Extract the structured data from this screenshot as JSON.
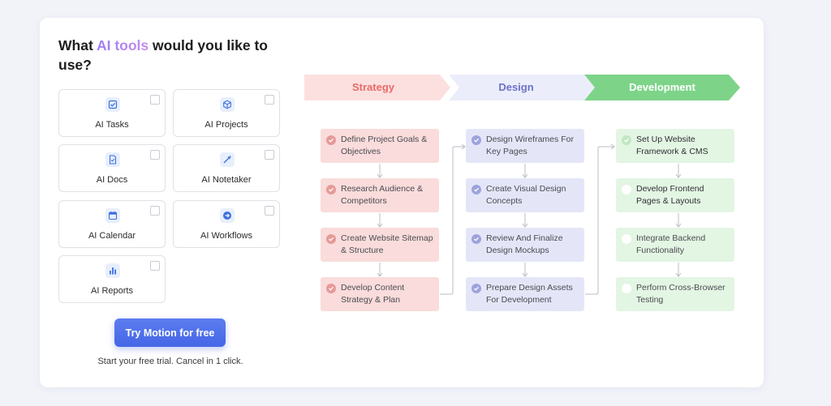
{
  "heading": {
    "before": "What ",
    "accent": "AI tools",
    "after": " would you like to use?"
  },
  "tools": [
    {
      "label": "AI Tasks",
      "icon": "task-check-icon"
    },
    {
      "label": "AI Projects",
      "icon": "cube-icon"
    },
    {
      "label": "AI Docs",
      "icon": "doc-icon"
    },
    {
      "label": "AI Notetaker",
      "icon": "pen-sparkle-icon"
    },
    {
      "label": "AI Calendar",
      "icon": "calendar-icon"
    },
    {
      "label": "AI Workflows",
      "icon": "arrow-circle-icon"
    },
    {
      "label": "AI Reports",
      "icon": "bar-chart-icon"
    }
  ],
  "cta": {
    "label": "Try Motion for free"
  },
  "trial_text": "Start your free trial. Cancel in 1 click.",
  "stages": [
    {
      "name": "Strategy",
      "color": "#e86a6a",
      "bg": "#fbe0df",
      "tasks": [
        "Define Project Goals & Objectives",
        "Research Audience & Competitors",
        "Create Website Sitemap & Structure",
        "Develop Content Strategy & Plan"
      ],
      "done": [
        true,
        true,
        true,
        true
      ]
    },
    {
      "name": "Design",
      "color": "#6b72c9",
      "bg": "#ecedfa",
      "tasks": [
        "Design Wireframes For Key Pages",
        "Create Visual Design Concepts",
        "Review And Finalize Design Mockups",
        "Prepare Design Assets For Development"
      ],
      "done": [
        true,
        true,
        true,
        true
      ]
    },
    {
      "name": "Development",
      "color": "#ffffff",
      "bg": "#7dd488",
      "tasks": [
        "Set Up Website Framework & CMS",
        "Develop Frontend Pages & Layouts",
        "Integrate Backend Functionality",
        "Perform Cross-Browser Testing"
      ],
      "done": [
        true,
        false,
        false,
        false
      ]
    }
  ],
  "colors": {
    "strategy_task_bg": "#f9dcdb",
    "strategy_dot": "#e69a98",
    "design_task_bg": "#e4e6f8",
    "design_dot": "#9ea3dc",
    "dev_task_bg": "#e3f5e3",
    "dev_dot": "#bfe8c2"
  }
}
